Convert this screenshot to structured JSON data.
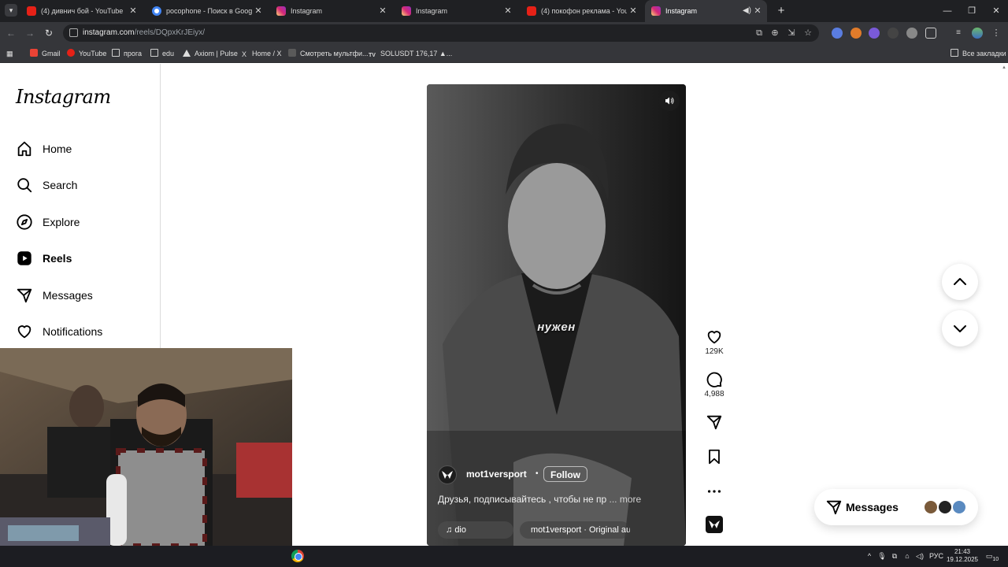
{
  "browser": {
    "tabs": [
      {
        "title": "(4) дивнич бой - YouTube",
        "favicon": "youtube-icon",
        "active": false
      },
      {
        "title": "pocophone - Поиск в Google",
        "favicon": "google-icon",
        "active": false
      },
      {
        "title": "Instagram",
        "favicon": "instagram-icon",
        "active": false
      },
      {
        "title": "Instagram",
        "favicon": "instagram-icon",
        "active": false
      },
      {
        "title": "(4) покофон реклама - YouTube",
        "favicon": "youtube-icon",
        "active": false
      },
      {
        "title": "Instagram",
        "favicon": "instagram-icon",
        "active": true
      }
    ],
    "url_host": "instagram.com",
    "url_path": "/reels/DQpxKrJEiyx/",
    "bookmarks": [
      {
        "label": "Gmail",
        "icon": "gmail-icon"
      },
      {
        "label": "YouTube",
        "icon": "youtube-icon"
      },
      {
        "label": "прога",
        "icon": "folder-icon"
      },
      {
        "label": "edu",
        "icon": "folder-icon"
      },
      {
        "label": "Axiom | Pulse",
        "icon": "axiom-icon"
      },
      {
        "label": "Home / X",
        "icon": "x-icon"
      },
      {
        "label": "Смотреть мультфи...",
        "icon": "site-icon"
      },
      {
        "label": "SOLUSDT 176,17 ▲...",
        "icon": "tradingview-icon"
      }
    ],
    "all_bookmarks": "Все закладки"
  },
  "sidebar": {
    "logo": "Instagram",
    "items": [
      {
        "label": "Home",
        "icon": "home-icon",
        "active": false
      },
      {
        "label": "Search",
        "icon": "search-icon",
        "active": false
      },
      {
        "label": "Explore",
        "icon": "compass-icon",
        "active": false
      },
      {
        "label": "Reels",
        "icon": "reels-icon",
        "active": true
      },
      {
        "label": "Messages",
        "icon": "paper-plane-icon",
        "active": false
      },
      {
        "label": "Notifications",
        "icon": "heart-icon",
        "active": false
      }
    ]
  },
  "reel": {
    "subtitle": "нужен",
    "author": "mot1versport",
    "separator": "•",
    "follow": "Follow",
    "caption": "Друзья, подписывайтесь , чтобы не пр",
    "more": "... more",
    "audio_short": "dio",
    "audio_track": "mot1versport · Original au",
    "mute_icon": "speaker-icon"
  },
  "actions": {
    "likes": "129K",
    "comments": "4,988"
  },
  "messages": {
    "label": "Messages"
  },
  "taskbar": {
    "language": "РУС",
    "time": "21:43",
    "date": "19.12.2025",
    "notifications": "10"
  },
  "colors": {
    "accent": "#000000",
    "chrome_dark": "#35363a"
  }
}
